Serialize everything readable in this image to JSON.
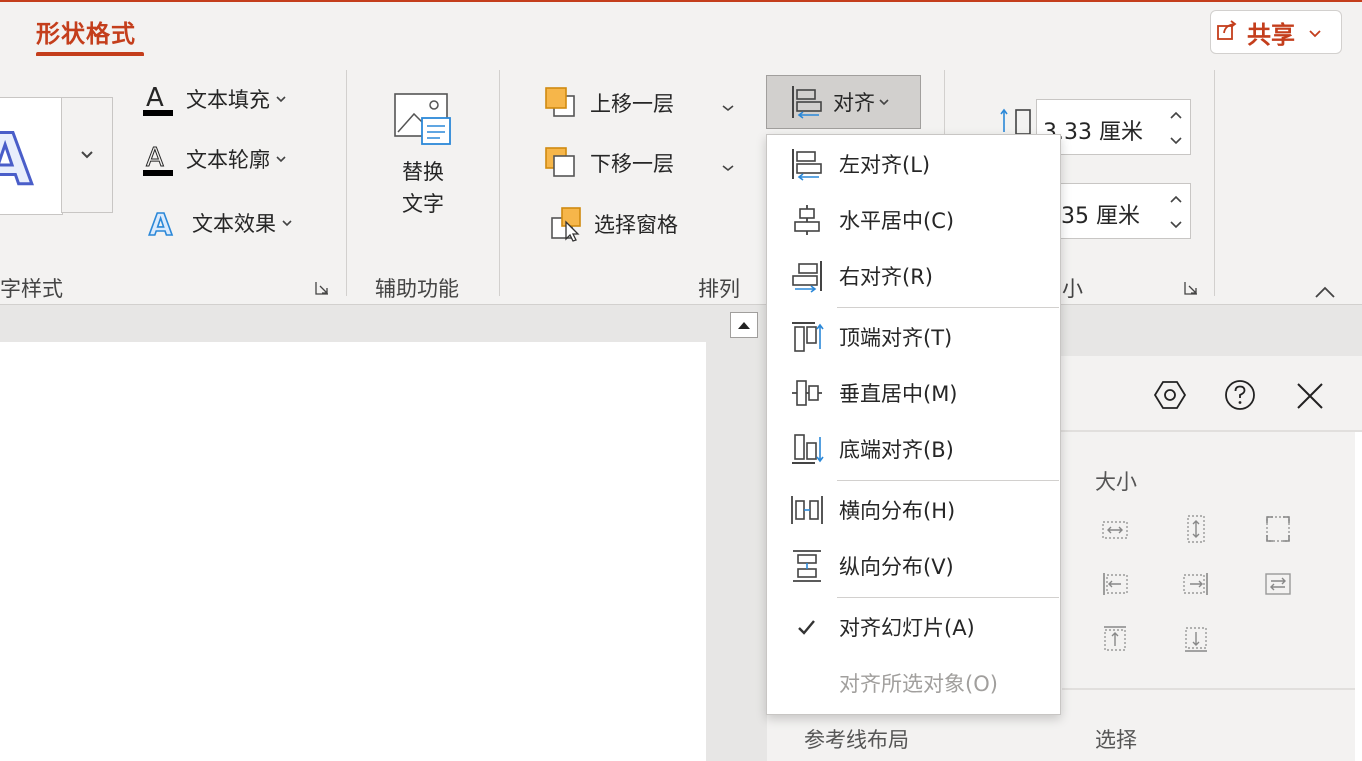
{
  "tabs": {
    "shape_format": "形状格式"
  },
  "share": {
    "label": "共享"
  },
  "ribbon": {
    "wordart": {
      "text_fill": "文本填充",
      "text_outline": "文本轮廓",
      "text_effects": "文本效果",
      "group_label": "字样式"
    },
    "accessibility": {
      "alt_text_line1": "替换",
      "alt_text_line2": "文字",
      "group_label": "辅助功能"
    },
    "arrange": {
      "bring_forward": "上移一层",
      "send_backward": "下移一层",
      "selection_pane": "选择窗格",
      "align": "对齐",
      "group_label": "排列"
    },
    "size": {
      "height_value": "3.33 厘米",
      "width_value": "35 厘米",
      "group_label": "小"
    }
  },
  "align_menu": {
    "items": [
      {
        "label": "左对齐(L)",
        "icon": "align-left-icon"
      },
      {
        "label": "水平居中(C)",
        "icon": "align-center-icon"
      },
      {
        "label": "右对齐(R)",
        "icon": "align-right-icon"
      },
      {
        "label": "顶端对齐(T)",
        "icon": "align-top-icon"
      },
      {
        "label": "垂直居中(M)",
        "icon": "align-middle-icon"
      },
      {
        "label": "底端对齐(B)",
        "icon": "align-bottom-icon"
      },
      {
        "label": "横向分布(H)",
        "icon": "distribute-horizontal-icon"
      },
      {
        "label": "纵向分布(V)",
        "icon": "distribute-vertical-icon"
      },
      {
        "label": "对齐幻灯片(A)",
        "icon": "check-icon",
        "checked": true
      },
      {
        "label": "对齐所选对象(O)",
        "icon": "",
        "disabled": true
      }
    ]
  },
  "pane": {
    "size_heading": "大小",
    "guides_layout": "参考线布局",
    "select": "选择"
  },
  "colors": {
    "accent": "#c43e1c",
    "icon_blue": "#2b88d8",
    "icon_orange": "#f0a030"
  }
}
